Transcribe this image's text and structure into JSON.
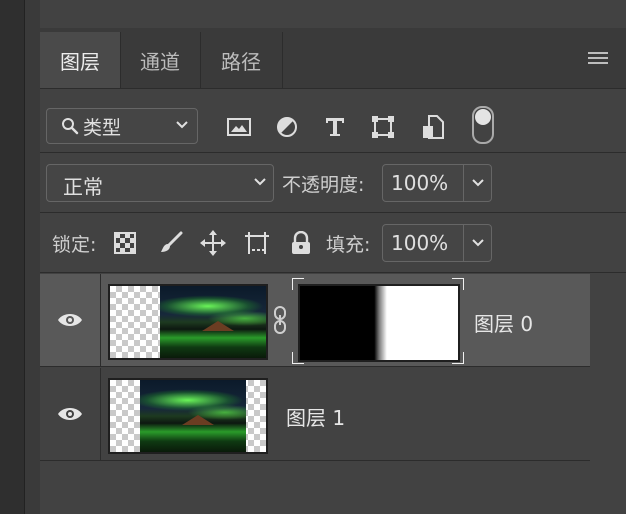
{
  "tabs": [
    {
      "label": "图层",
      "active": true
    },
    {
      "label": "通道",
      "active": false
    },
    {
      "label": "路径",
      "active": false
    }
  ],
  "filter": {
    "kind_label": "类型"
  },
  "blend": {
    "mode": "正常",
    "opacity_label": "不透明度:",
    "opacity_value": "100%"
  },
  "lock": {
    "label": "锁定:",
    "fill_label": "填充:",
    "fill_value": "100%"
  },
  "layers": [
    {
      "name": "图层 0",
      "visible": true,
      "selected": true,
      "has_mask": true
    },
    {
      "name": "图层 1",
      "visible": true,
      "selected": false,
      "has_mask": false
    }
  ],
  "icons": {
    "filter": [
      "search-icon",
      "image-filter-icon",
      "adjustment-filter-icon",
      "type-filter-icon",
      "shape-filter-icon",
      "smart-object-filter-icon"
    ],
    "lock": [
      "lock-transparent-pixels-icon",
      "lock-image-pixels-icon",
      "lock-position-icon",
      "lock-artboard-icon",
      "lock-all-icon"
    ]
  }
}
